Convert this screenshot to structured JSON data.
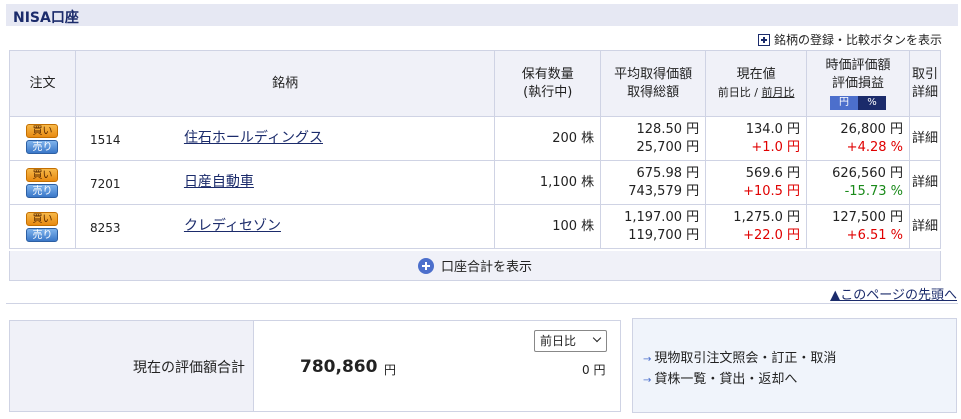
{
  "section": {
    "title": "NISA口座"
  },
  "toggle_compare": {
    "label": "銘柄の登録・比較ボタンを表示"
  },
  "table": {
    "headers": {
      "order": "注文",
      "name": "銘柄",
      "qty_line1": "保有数量",
      "qty_line2": "(執行中)",
      "avg_line1": "平均取得価額",
      "avg_line2": "取得総額",
      "price_line1": "現在値",
      "price_sub_day": "前日比",
      "price_sub_sep": "/",
      "price_sub_month": "前月比",
      "val_line1": "時価評価額",
      "val_line2": "評価損益",
      "val_toggle_yen": "円",
      "val_toggle_pct": "%",
      "act_line1": "取引",
      "act_line2": "詳細"
    },
    "rows": [
      {
        "buy": "買い",
        "sell": "売り",
        "code": "1514",
        "name": "住石ホールディングス",
        "qty": "200 株",
        "avg_price": "128.50 円",
        "total_cost": "25,700 円",
        "current": "134.0 円",
        "change": "+1.0 円",
        "market_value": "26,800 円",
        "pl_pct": "+4.28 %",
        "detail": "詳細"
      },
      {
        "buy": "買い",
        "sell": "売り",
        "code": "7201",
        "name": "日産自動車",
        "qty": "1,100 株",
        "avg_price": "675.98 円",
        "total_cost": "743,579 円",
        "current": "569.6 円",
        "change": "+10.5 円",
        "market_value": "626,560 円",
        "pl_pct": "-15.73 %",
        "detail": "詳細"
      },
      {
        "buy": "買い",
        "sell": "売り",
        "code": "8253",
        "name": "クレディセゾン",
        "qty": "100 株",
        "avg_price": "1,197.00 円",
        "total_cost": "119,700 円",
        "current": "1,275.0 円",
        "change": "+22.0 円",
        "market_value": "127,500 円",
        "pl_pct": "+6.51 %",
        "detail": "詳細"
      }
    ]
  },
  "summary_toggle": {
    "label": "口座合計を表示"
  },
  "page_top": {
    "label": "▲このページの先頭へ"
  },
  "total": {
    "label": "現在の評価額合計",
    "value": "780,860",
    "unit": "円",
    "select_value": "前日比",
    "diff": "0 円"
  },
  "links": [
    {
      "label": "現物取引注文照会・訂正・取消"
    },
    {
      "label": "貸株一覧・貸出・返却へ"
    }
  ],
  "colors": {
    "accent": "#1b2b6b",
    "up": "#e00000",
    "down": "#1a8a1a",
    "header_bg": "#f0f1f8"
  }
}
